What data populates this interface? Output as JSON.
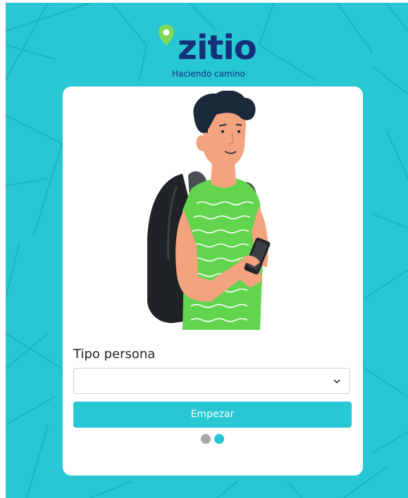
{
  "brand": {
    "name": "zitio",
    "tagline": "Haciendo camino",
    "primary_color": "#27c7d3",
    "text_color": "#16307a",
    "pin_color": "#7ed957"
  },
  "form": {
    "label": "Tipo persona",
    "select": {
      "value": "",
      "placeholder": ""
    },
    "submit_label": "Empezar"
  },
  "pagination": {
    "total": 2,
    "active": 2
  },
  "illustration": {
    "icon": "person-with-phone-and-backpack-illustration"
  }
}
